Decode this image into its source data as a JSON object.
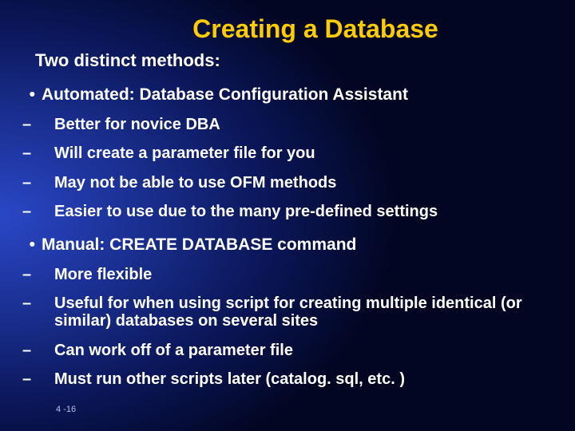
{
  "title": "Creating a Database",
  "subtitle": "Two distinct methods:",
  "items": [
    {
      "label": "Automated: Database Configuration Assistant",
      "subs": [
        "Better for novice DBA",
        "Will create a parameter file for you",
        "May not be able to use OFM methods",
        "Easier to use due to the many pre-defined settings"
      ]
    },
    {
      "label": "Manual: CREATE DATABASE command",
      "subs": [
        "More flexible",
        "Useful for when using script for creating multiple identical (or similar) databases on several sites",
        "Can work off of a parameter file",
        "Must run other scripts later (catalog. sql, etc. )"
      ]
    }
  ],
  "page_num": "4 -16"
}
